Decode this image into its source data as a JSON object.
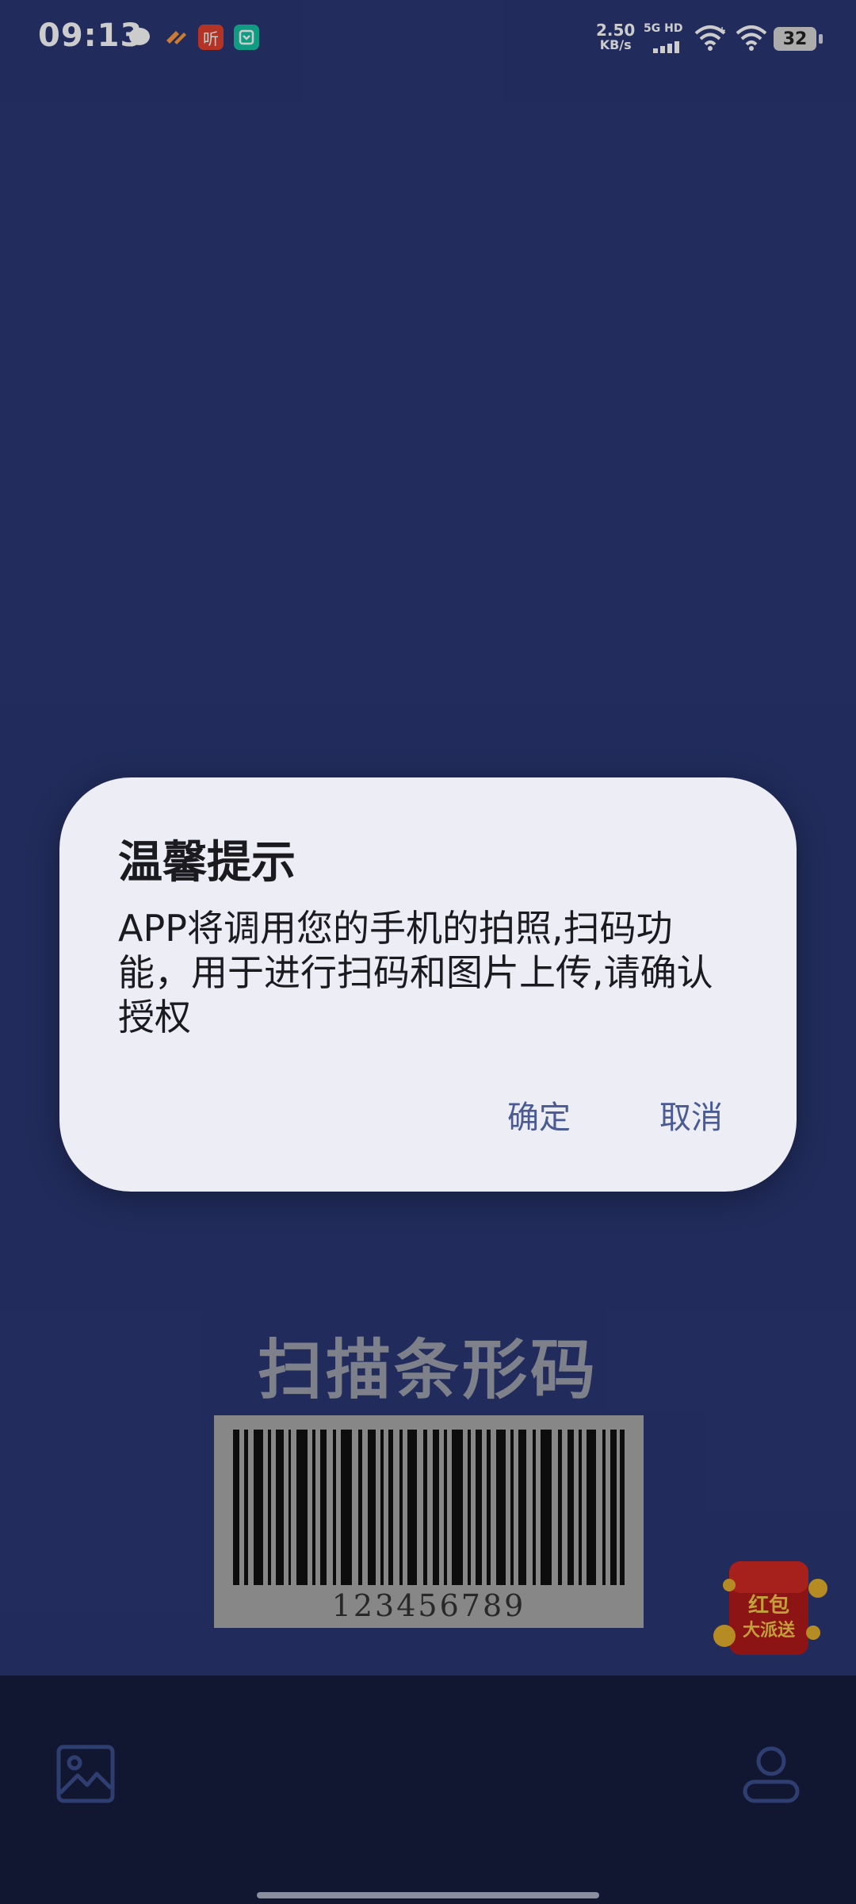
{
  "status_bar": {
    "time": "09:13",
    "net_speed_value": "2.50",
    "net_speed_unit": "KB/s",
    "network_type": "5G HD",
    "battery_level": "32",
    "notification_icons": [
      "message-icon",
      "cloud-app-icon",
      "ting-app-icon",
      "shield-app-icon"
    ],
    "ting_label": "听"
  },
  "scan_section": {
    "title": "扫描条形码",
    "barcode_number": "123456789"
  },
  "promo": {
    "label_line1": "红包",
    "label_line2": "大派送"
  },
  "dialog": {
    "title": "温馨提示",
    "message": "APP将调用您的手机的拍照,扫码功能，用于进行扫码和图片上传,请确认授权",
    "confirm_label": "确定",
    "cancel_label": "取消"
  },
  "bottom_nav": {
    "left_icon": "gallery-icon",
    "right_icon": "profile-icon"
  },
  "colors": {
    "background": "#2a3874",
    "dialog": "#ededf6",
    "button_text": "#4a5a93",
    "bottom_nav": "#111631"
  }
}
